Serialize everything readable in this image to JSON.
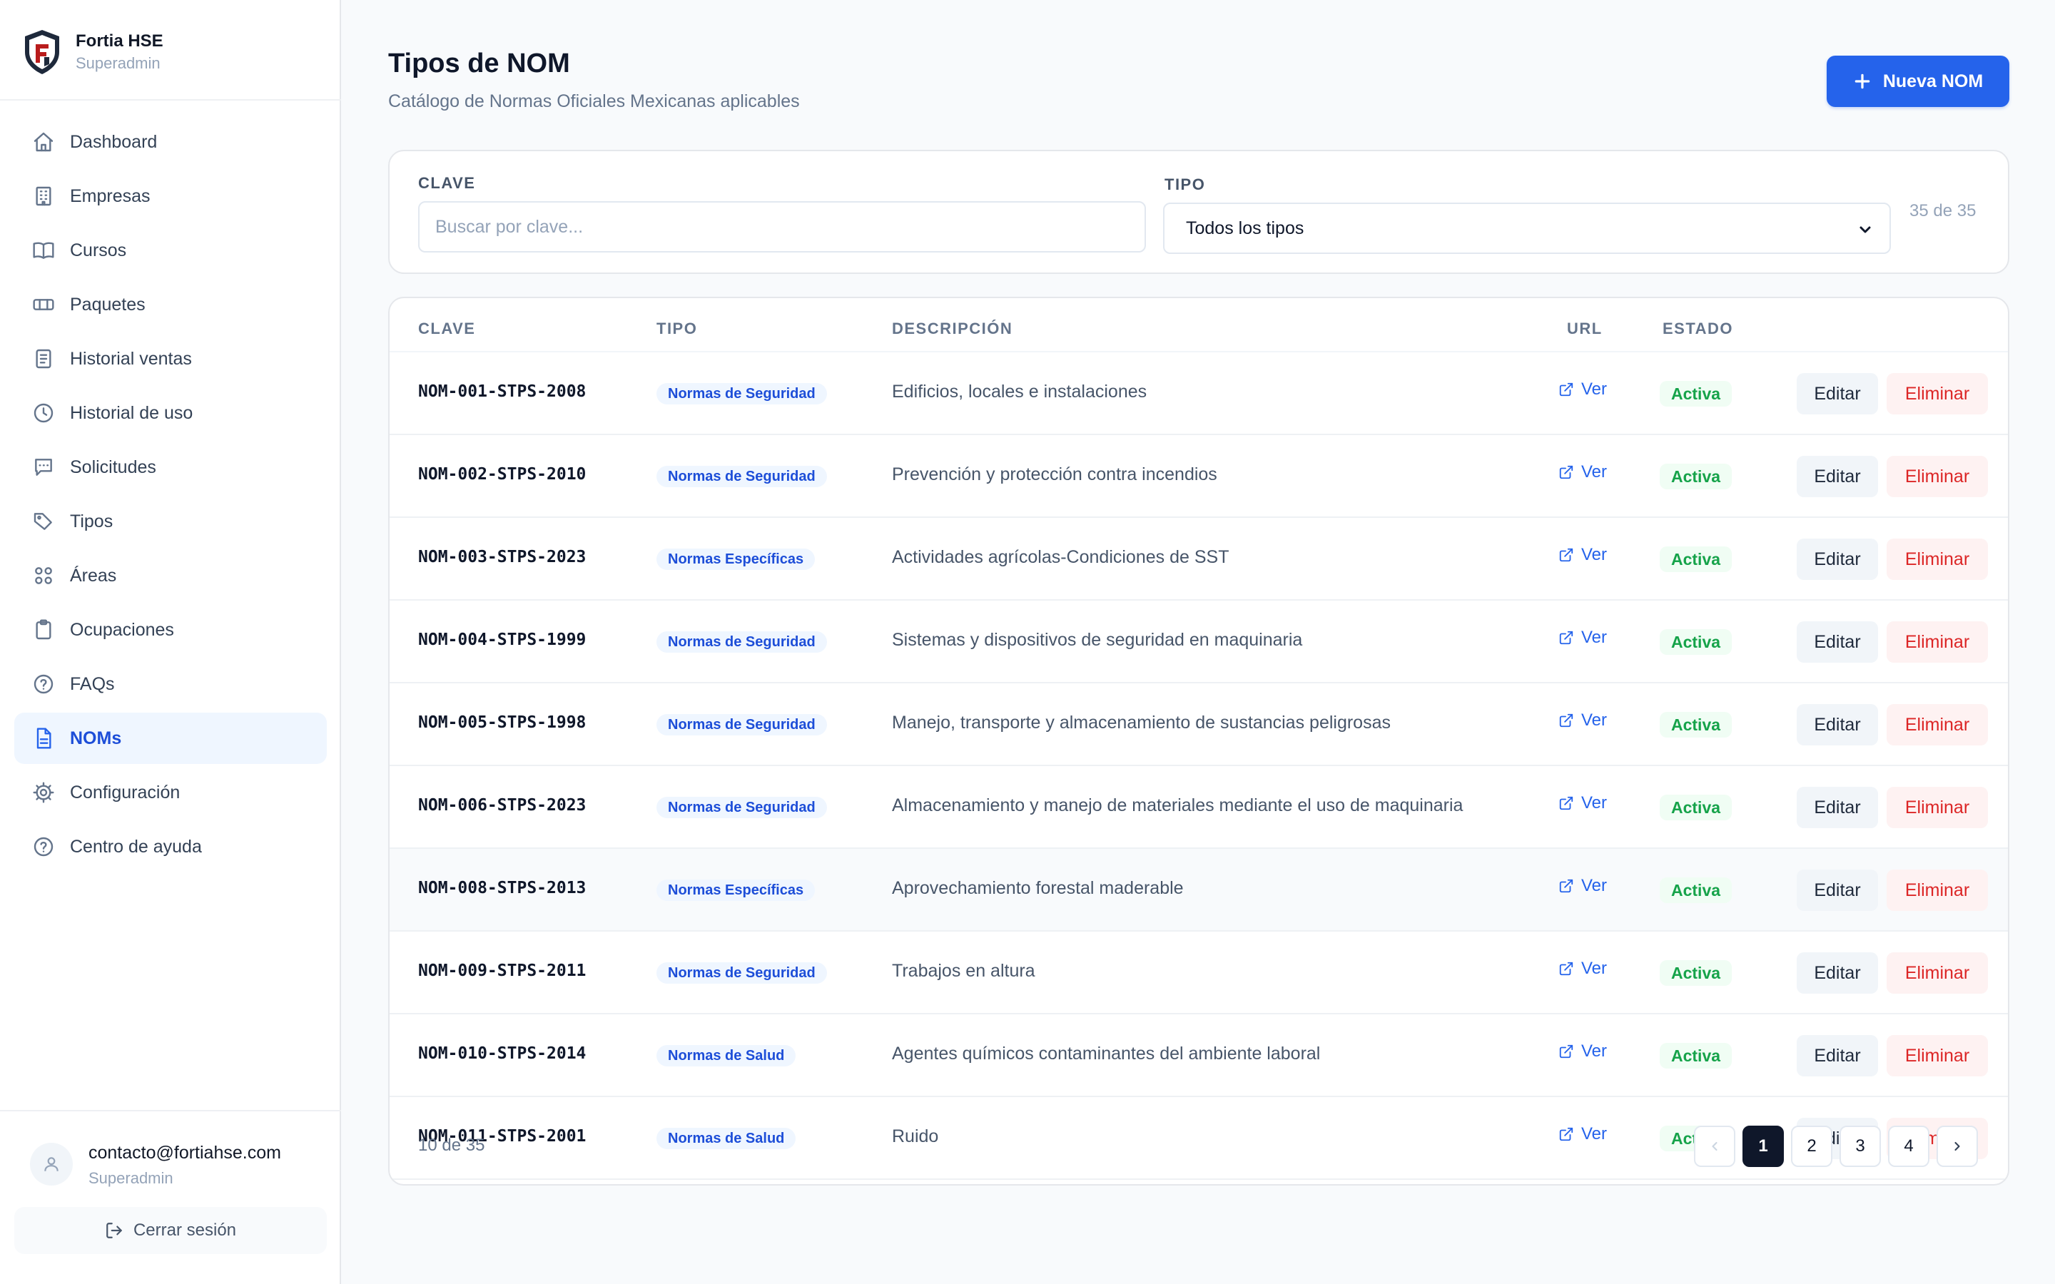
{
  "brand": {
    "name": "Fortia HSE",
    "role": "Superadmin"
  },
  "nav": [
    {
      "id": "dashboard",
      "label": "Dashboard",
      "icon": "home-icon",
      "active": false
    },
    {
      "id": "empresas",
      "label": "Empresas",
      "icon": "building-icon",
      "active": false
    },
    {
      "id": "cursos",
      "label": "Cursos",
      "icon": "book-icon",
      "active": false
    },
    {
      "id": "paquetes",
      "label": "Paquetes",
      "icon": "ticket-icon",
      "active": false
    },
    {
      "id": "historial-ventas",
      "label": "Historial ventas",
      "icon": "receipt-icon",
      "active": false
    },
    {
      "id": "historial-uso",
      "label": "Historial de uso",
      "icon": "clock-icon",
      "active": false
    },
    {
      "id": "solicitudes",
      "label": "Solicitudes",
      "icon": "message-icon",
      "active": false
    },
    {
      "id": "tipos",
      "label": "Tipos",
      "icon": "tag-icon",
      "active": false
    },
    {
      "id": "areas",
      "label": "Áreas",
      "icon": "grid-icon",
      "active": false
    },
    {
      "id": "ocupaciones",
      "label": "Ocupaciones",
      "icon": "clipboard-icon",
      "active": false
    },
    {
      "id": "faqs",
      "label": "FAQs",
      "icon": "help-circle-icon",
      "active": false
    },
    {
      "id": "noms",
      "label": "NOMs",
      "icon": "document-icon",
      "active": true
    },
    {
      "id": "configuracion",
      "label": "Configuración",
      "icon": "gear-icon",
      "active": false
    },
    {
      "id": "centro-ayuda",
      "label": "Centro de ayuda",
      "icon": "help-circle-icon",
      "active": false
    }
  ],
  "user": {
    "email": "contacto@fortiahse.com",
    "role": "Superadmin",
    "logout_label": "Cerrar sesión"
  },
  "header": {
    "title": "Tipos de NOM",
    "subtitle": "Catálogo de Normas Oficiales Mexicanas aplicables",
    "new_button": "Nueva NOM"
  },
  "filters": {
    "clave_label": "CLAVE",
    "clave_placeholder": "Buscar por clave...",
    "clave_value": "",
    "tipo_label": "TIPO",
    "tipo_value": "Todos los tipos",
    "count": "35 de 35"
  },
  "table": {
    "headers": {
      "clave": "CLAVE",
      "tipo": "TIPO",
      "descripcion": "DESCRIPCIÓN",
      "url": "URL",
      "estado": "ESTADO"
    },
    "link_label": "Ver",
    "edit_label": "Editar",
    "delete_label": "Eliminar",
    "rows": [
      {
        "clave": "NOM-001-STPS-2008",
        "tipo": "Normas de Seguridad",
        "descripcion": "Edificios, locales e instalaciones",
        "estado": "Activa"
      },
      {
        "clave": "NOM-002-STPS-2010",
        "tipo": "Normas de Seguridad",
        "descripcion": "Prevención y protección contra incendios",
        "estado": "Activa"
      },
      {
        "clave": "NOM-003-STPS-2023",
        "tipo": "Normas Específicas",
        "descripcion": "Actividades agrícolas-Condiciones de SST",
        "estado": "Activa"
      },
      {
        "clave": "NOM-004-STPS-1999",
        "tipo": "Normas de Seguridad",
        "descripcion": "Sistemas y dispositivos de seguridad en maquinaria",
        "estado": "Activa"
      },
      {
        "clave": "NOM-005-STPS-1998",
        "tipo": "Normas de Seguridad",
        "descripcion": "Manejo, transporte y almacenamiento de sustancias peligrosas",
        "estado": "Activa"
      },
      {
        "clave": "NOM-006-STPS-2023",
        "tipo": "Normas de Seguridad",
        "descripcion": "Almacenamiento y manejo de materiales mediante el uso de maquinaria",
        "estado": "Activa"
      },
      {
        "clave": "NOM-008-STPS-2013",
        "tipo": "Normas Específicas",
        "descripcion": "Aprovechamiento forestal maderable",
        "estado": "Activa"
      },
      {
        "clave": "NOM-009-STPS-2011",
        "tipo": "Normas de Seguridad",
        "descripcion": "Trabajos en altura",
        "estado": "Activa"
      },
      {
        "clave": "NOM-010-STPS-2014",
        "tipo": "Normas de Salud",
        "descripcion": "Agentes químicos contaminantes del ambiente laboral",
        "estado": "Activa"
      },
      {
        "clave": "NOM-011-STPS-2001",
        "tipo": "Normas de Salud",
        "descripcion": "Ruido",
        "estado": "Activa"
      }
    ]
  },
  "pagination": {
    "info": "10 de 35",
    "pages": [
      "1",
      "2",
      "3",
      "4"
    ],
    "current": "1"
  },
  "colors": {
    "accent": "#2563eb",
    "active_bg": "#eff6ff",
    "success": "#16a34a",
    "danger": "#dc2626",
    "dark": "#0f172a"
  }
}
